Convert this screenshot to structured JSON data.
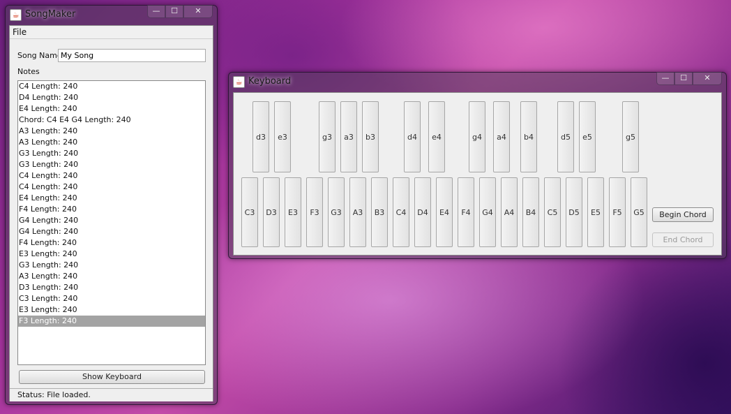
{
  "songmaker": {
    "title": "SongMaker",
    "menu": {
      "file": "File"
    },
    "song_name_label": "Song Name",
    "song_name_value": "My Song",
    "notes_label": "Notes",
    "notes": [
      "C4  Length: 240",
      "D4  Length: 240",
      "E4  Length: 240",
      "Chord: C4 E4 G4 Length: 240",
      "A3  Length: 240",
      "A3  Length: 240",
      "G3  Length: 240",
      "G3  Length: 240",
      "C4  Length: 240",
      "C4  Length: 240",
      "E4  Length: 240",
      "F4  Length: 240",
      "G4  Length: 240",
      "G4  Length: 240",
      "F4  Length: 240",
      "E3  Length: 240",
      "G3  Length: 240",
      "A3  Length: 240",
      "D3  Length: 240",
      "C3  Length: 240",
      "E3  Length: 240",
      "F3  Length: 240"
    ],
    "selected_note_index": 21,
    "show_keyboard_button": "Show Keyboard",
    "status_text": "Status:  File loaded."
  },
  "keyboard": {
    "title": "Keyboard",
    "sharp_keys": [
      "d3",
      "e3",
      "g3",
      "a3",
      "b3",
      "d4",
      "e4",
      "g4",
      "a4",
      "b4",
      "d5",
      "e5",
      "g5"
    ],
    "natural_keys": [
      "C3",
      "D3",
      "E3",
      "F3",
      "G3",
      "A3",
      "B3",
      "C4",
      "D4",
      "E4",
      "F4",
      "G4",
      "A4",
      "B4",
      "C5",
      "D5",
      "E5",
      "F5",
      "G5"
    ],
    "begin_chord_button": "Begin Chord",
    "end_chord_button": "End Chord"
  },
  "window_controls": {
    "minimize": "—",
    "maximize": "☐",
    "close": "✕"
  }
}
